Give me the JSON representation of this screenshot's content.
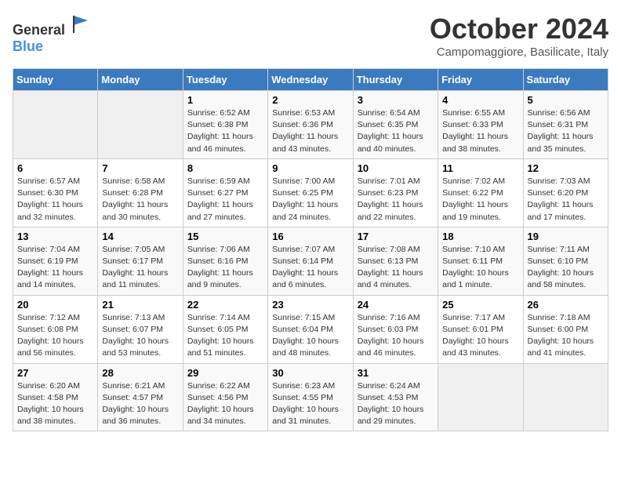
{
  "logo": {
    "text_general": "General",
    "text_blue": "Blue"
  },
  "title": "October 2024",
  "subtitle": "Campomaggiore, Basilicate, Italy",
  "days_of_week": [
    "Sunday",
    "Monday",
    "Tuesday",
    "Wednesday",
    "Thursday",
    "Friday",
    "Saturday"
  ],
  "weeks": [
    [
      {
        "day": "",
        "empty": true
      },
      {
        "day": "",
        "empty": true
      },
      {
        "day": "1",
        "sunrise": "6:52 AM",
        "sunset": "6:38 PM",
        "daylight": "11 hours and 46 minutes."
      },
      {
        "day": "2",
        "sunrise": "6:53 AM",
        "sunset": "6:36 PM",
        "daylight": "11 hours and 43 minutes."
      },
      {
        "day": "3",
        "sunrise": "6:54 AM",
        "sunset": "6:35 PM",
        "daylight": "11 hours and 40 minutes."
      },
      {
        "day": "4",
        "sunrise": "6:55 AM",
        "sunset": "6:33 PM",
        "daylight": "11 hours and 38 minutes."
      },
      {
        "day": "5",
        "sunrise": "6:56 AM",
        "sunset": "6:31 PM",
        "daylight": "11 hours and 35 minutes."
      }
    ],
    [
      {
        "day": "6",
        "sunrise": "6:57 AM",
        "sunset": "6:30 PM",
        "daylight": "11 hours and 32 minutes."
      },
      {
        "day": "7",
        "sunrise": "6:58 AM",
        "sunset": "6:28 PM",
        "daylight": "11 hours and 30 minutes."
      },
      {
        "day": "8",
        "sunrise": "6:59 AM",
        "sunset": "6:27 PM",
        "daylight": "11 hours and 27 minutes."
      },
      {
        "day": "9",
        "sunrise": "7:00 AM",
        "sunset": "6:25 PM",
        "daylight": "11 hours and 24 minutes."
      },
      {
        "day": "10",
        "sunrise": "7:01 AM",
        "sunset": "6:23 PM",
        "daylight": "11 hours and 22 minutes."
      },
      {
        "day": "11",
        "sunrise": "7:02 AM",
        "sunset": "6:22 PM",
        "daylight": "11 hours and 19 minutes."
      },
      {
        "day": "12",
        "sunrise": "7:03 AM",
        "sunset": "6:20 PM",
        "daylight": "11 hours and 17 minutes."
      }
    ],
    [
      {
        "day": "13",
        "sunrise": "7:04 AM",
        "sunset": "6:19 PM",
        "daylight": "11 hours and 14 minutes."
      },
      {
        "day": "14",
        "sunrise": "7:05 AM",
        "sunset": "6:17 PM",
        "daylight": "11 hours and 11 minutes."
      },
      {
        "day": "15",
        "sunrise": "7:06 AM",
        "sunset": "6:16 PM",
        "daylight": "11 hours and 9 minutes."
      },
      {
        "day": "16",
        "sunrise": "7:07 AM",
        "sunset": "6:14 PM",
        "daylight": "11 hours and 6 minutes."
      },
      {
        "day": "17",
        "sunrise": "7:08 AM",
        "sunset": "6:13 PM",
        "daylight": "11 hours and 4 minutes."
      },
      {
        "day": "18",
        "sunrise": "7:10 AM",
        "sunset": "6:11 PM",
        "daylight": "10 hours and 1 minute."
      },
      {
        "day": "19",
        "sunrise": "7:11 AM",
        "sunset": "6:10 PM",
        "daylight": "10 hours and 58 minutes."
      }
    ],
    [
      {
        "day": "20",
        "sunrise": "7:12 AM",
        "sunset": "6:08 PM",
        "daylight": "10 hours and 56 minutes."
      },
      {
        "day": "21",
        "sunrise": "7:13 AM",
        "sunset": "6:07 PM",
        "daylight": "10 hours and 53 minutes."
      },
      {
        "day": "22",
        "sunrise": "7:14 AM",
        "sunset": "6:05 PM",
        "daylight": "10 hours and 51 minutes."
      },
      {
        "day": "23",
        "sunrise": "7:15 AM",
        "sunset": "6:04 PM",
        "daylight": "10 hours and 48 minutes."
      },
      {
        "day": "24",
        "sunrise": "7:16 AM",
        "sunset": "6:03 PM",
        "daylight": "10 hours and 46 minutes."
      },
      {
        "day": "25",
        "sunrise": "7:17 AM",
        "sunset": "6:01 PM",
        "daylight": "10 hours and 43 minutes."
      },
      {
        "day": "26",
        "sunrise": "7:18 AM",
        "sunset": "6:00 PM",
        "daylight": "10 hours and 41 minutes."
      }
    ],
    [
      {
        "day": "27",
        "sunrise": "6:20 AM",
        "sunset": "4:58 PM",
        "daylight": "10 hours and 38 minutes."
      },
      {
        "day": "28",
        "sunrise": "6:21 AM",
        "sunset": "4:57 PM",
        "daylight": "10 hours and 36 minutes."
      },
      {
        "day": "29",
        "sunrise": "6:22 AM",
        "sunset": "4:56 PM",
        "daylight": "10 hours and 34 minutes."
      },
      {
        "day": "30",
        "sunrise": "6:23 AM",
        "sunset": "4:55 PM",
        "daylight": "10 hours and 31 minutes."
      },
      {
        "day": "31",
        "sunrise": "6:24 AM",
        "sunset": "4:53 PM",
        "daylight": "10 hours and 29 minutes."
      },
      {
        "day": "",
        "empty": true
      },
      {
        "day": "",
        "empty": true
      }
    ]
  ],
  "labels": {
    "sunrise": "Sunrise:",
    "sunset": "Sunset:",
    "daylight": "Daylight:"
  }
}
